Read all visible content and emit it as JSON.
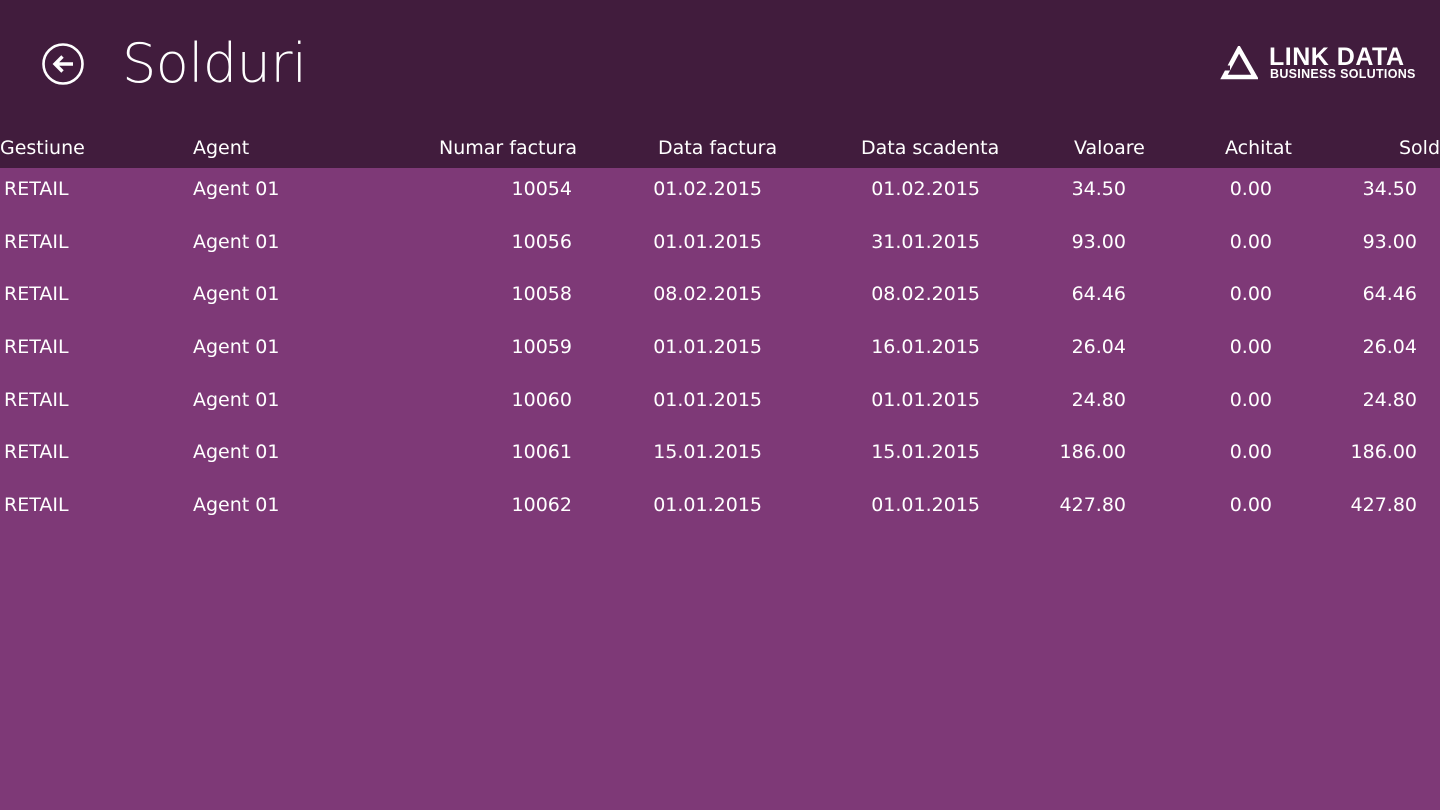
{
  "header": {
    "title": "Solduri",
    "back_icon": "arrow-left-circle-icon",
    "logo": {
      "name": "LINK DATA",
      "tagline": "BUSINESS SOLUTIONS"
    }
  },
  "colors": {
    "header_bg": "#411c3d",
    "content_bg": "#7e3977",
    "text": "#ffffff"
  },
  "table": {
    "columns": [
      "Gestiune",
      "Agent",
      "Numar factura",
      "Data factura",
      "Data scadenta",
      "Valoare",
      "Achitat",
      "Sold"
    ],
    "rows": [
      [
        "RETAIL",
        "Agent 01",
        "10054",
        "01.02.2015",
        "01.02.2015",
        "34.50",
        "0.00",
        "34.50"
      ],
      [
        "RETAIL",
        "Agent 01",
        "10056",
        "01.01.2015",
        "31.01.2015",
        "93.00",
        "0.00",
        "93.00"
      ],
      [
        "RETAIL",
        "Agent 01",
        "10058",
        "08.02.2015",
        "08.02.2015",
        "64.46",
        "0.00",
        "64.46"
      ],
      [
        "RETAIL",
        "Agent 01",
        "10059",
        "01.01.2015",
        "16.01.2015",
        "26.04",
        "0.00",
        "26.04"
      ],
      [
        "RETAIL",
        "Agent 01",
        "10060",
        "01.01.2015",
        "01.01.2015",
        "24.80",
        "0.00",
        "24.80"
      ],
      [
        "RETAIL",
        "Agent 01",
        "10061",
        "15.01.2015",
        "15.01.2015",
        "186.00",
        "0.00",
        "186.00"
      ],
      [
        "RETAIL",
        "Agent 01",
        "10062",
        "01.01.2015",
        "01.01.2015",
        "427.80",
        "0.00",
        "427.80"
      ]
    ]
  }
}
